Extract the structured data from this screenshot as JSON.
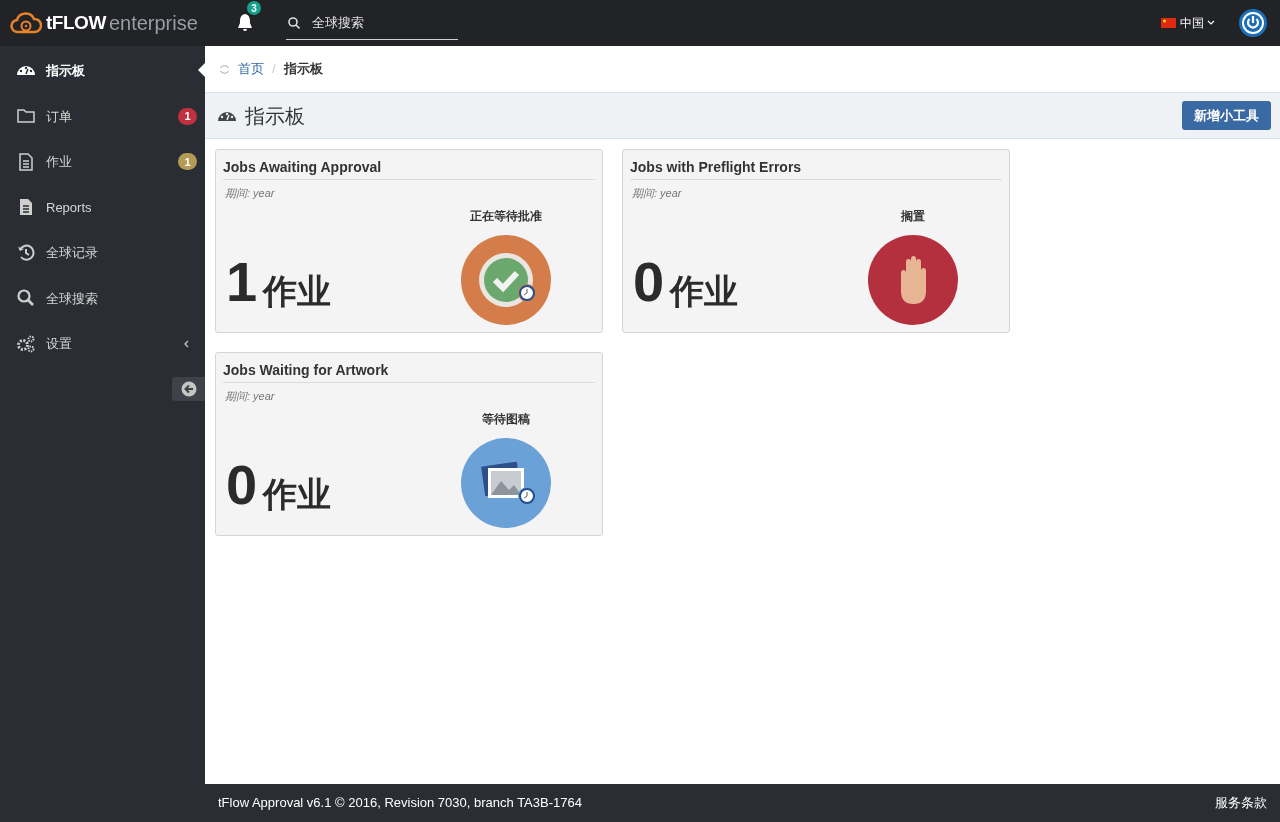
{
  "topbar": {
    "logo_bold": "tFLOW",
    "logo_light": "enterprise",
    "notifications": {
      "count": "3"
    },
    "search": {
      "placeholder": "全球搜索"
    },
    "language": "中国"
  },
  "sidebar": {
    "items": [
      {
        "kind": "dashboard",
        "label": "指示板",
        "selected": true
      },
      {
        "kind": "folder",
        "label": "订单",
        "selected": false,
        "badge": "1",
        "color": "#c0303f"
      },
      {
        "kind": "document",
        "label": "作业",
        "selected": false,
        "badge": "1",
        "color": "#b59a55"
      },
      {
        "kind": "report",
        "label": "Reports",
        "selected": false
      },
      {
        "kind": "history",
        "label": "全球记录",
        "selected": false
      },
      {
        "kind": "search",
        "label": "全球搜索",
        "selected": false
      },
      {
        "kind": "settings",
        "label": "设置",
        "selected": false,
        "expanded": false
      }
    ]
  },
  "breadcrumb": [
    "首页",
    "指示板"
  ],
  "breadcrumb_separator": "/",
  "page_title": "指示板",
  "add_button": "新增小工具",
  "widgets": [
    {
      "kind": "approval",
      "title": "Jobs Awaiting Approval",
      "period": "期间: year",
      "count": "1",
      "unit": "作业",
      "status": "正在等待批准"
    },
    {
      "kind": "preflight",
      "title": "Jobs with Preflight Errors",
      "period": "期间: year",
      "count": "0",
      "unit": "作业",
      "status": "搁置"
    },
    {
      "kind": "artwork",
      "title": "Jobs Waiting for Artwork",
      "period": "期间: year",
      "count": "0",
      "unit": "作业",
      "status": "等待图稿"
    }
  ],
  "footer": {
    "version": "tFlow Approval v6.1 © 2016, Revision 7030, branch TA3B-1764",
    "terms": "服务条款"
  }
}
